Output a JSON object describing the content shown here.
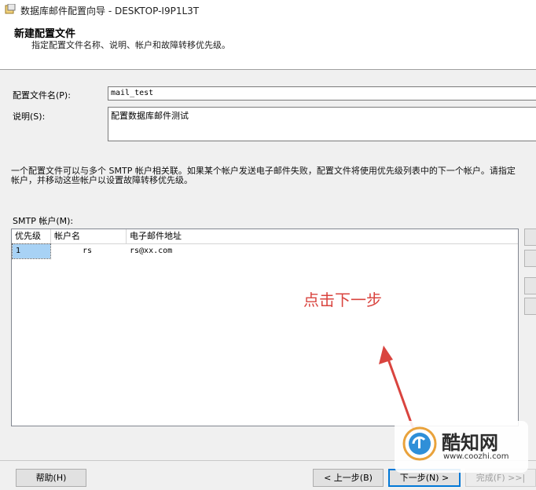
{
  "window": {
    "title": "数据库邮件配置向导 - DESKTOP-I9P1L3T",
    "icon": "wizard-app-icon"
  },
  "header": {
    "title": "新建配置文件",
    "subtitle": "指定配置文件名称、说明、帐户和故障转移优先级。"
  },
  "form": {
    "profile_name_label": "配置文件名(P):",
    "profile_name_value": "mail_test",
    "description_label": "说明(S):",
    "description_value": "配置数据库邮件测试"
  },
  "help_text": {
    "line1": "一个配置文件可以与多个 SMTP 帐户相关联。如果某个帐户发送电子邮件失败，配置文件将使用优先级列表中的下一个帐户。请指定",
    "line2": "帐户，并移动这些帐户以设置故障转移优先级。"
  },
  "smtp_grid": {
    "label": "SMTP 帐户(M):",
    "columns": [
      "优先级",
      "帐户名",
      "电子邮件地址"
    ],
    "rows": [
      {
        "priority": "1",
        "account": "rs",
        "email": "rs@xx.com"
      }
    ]
  },
  "annotation": {
    "text": "点击下一步",
    "color": "#d9443f"
  },
  "buttons": {
    "help": "帮助(H)",
    "back": "< 上一步(B)",
    "next": "下一步(N) >",
    "finish": "完成(F) >>|"
  },
  "watermark": {
    "name": "酷知网",
    "url": "www.coozhi.com"
  }
}
